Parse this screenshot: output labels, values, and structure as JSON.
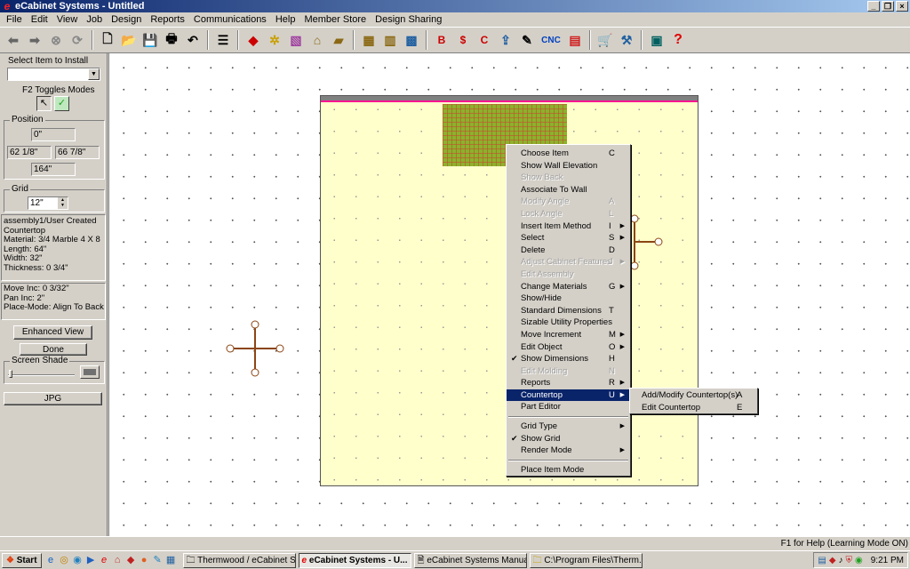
{
  "window": {
    "title": "eCabinet Systems - Untitled"
  },
  "menubar": [
    "File",
    "Edit",
    "View",
    "Job",
    "Design",
    "Reports",
    "Communications",
    "Help",
    "Member Store",
    "Design Sharing"
  ],
  "toolbar": {
    "cnc_label": "CNC"
  },
  "left_panel": {
    "select_label": "Select Item to Install",
    "select_value": "",
    "modes_label": "F2 Toggles Modes",
    "position_label": "Position",
    "position_values": {
      "top": "0\"",
      "left": "62 1/8\"",
      "right": "66 7/8\"",
      "bottom": "164\""
    },
    "grid_label": "Grid",
    "grid_value": "12\"",
    "info_lines": [
      "assembly1/User Created",
      "Countertop",
      " Material: 3/4 Marble 4 X 8",
      " Length: 64\"",
      " Width: 32\"",
      " Thickness: 0 3/4\""
    ],
    "move_lines": [
      "Move Inc: 0 3/32\"",
      "Pan Inc: 2\"",
      "Place-Mode: Align To Back"
    ],
    "enhanced_view_label": "Enhanced View",
    "done_label": "Done",
    "screen_shade_label": "Screen Shade",
    "jpg_label": "JPG"
  },
  "context_menu": [
    {
      "label": "Choose Item",
      "shortcut": "C"
    },
    {
      "label": "Show Wall Elevation",
      "shortcut": ""
    },
    {
      "label": "Show Back",
      "shortcut": "",
      "disabled": true
    },
    {
      "label": "Associate To Wall",
      "shortcut": ""
    },
    {
      "label": "Modify Angle",
      "shortcut": "A",
      "disabled": true
    },
    {
      "label": "Lock Angle",
      "shortcut": "L",
      "disabled": true
    },
    {
      "label": "Insert Item Method",
      "shortcut": "I",
      "submenu": true
    },
    {
      "label": "Select",
      "shortcut": "S",
      "submenu": true
    },
    {
      "label": "Delete",
      "shortcut": "D"
    },
    {
      "label": "Adjust Cabinet Features",
      "shortcut": "J",
      "submenu": true,
      "disabled": true
    },
    {
      "label": "Edit Assembly",
      "shortcut": "",
      "disabled": true
    },
    {
      "label": "Change Materials",
      "shortcut": "G",
      "submenu": true
    },
    {
      "label": "Show/Hide",
      "shortcut": ""
    },
    {
      "label": "Standard Dimensions",
      "shortcut": "T"
    },
    {
      "label": "Sizable Utility Properties",
      "shortcut": ""
    },
    {
      "label": "Move Increment",
      "shortcut": "M",
      "submenu": true
    },
    {
      "label": "Edit Object",
      "shortcut": "O",
      "submenu": true
    },
    {
      "label": "Show Dimensions",
      "shortcut": "H",
      "checked": true
    },
    {
      "label": "Edit Molding",
      "shortcut": "N",
      "disabled": true
    },
    {
      "label": "Reports",
      "shortcut": "R",
      "submenu": true
    },
    {
      "label": "Countertop",
      "shortcut": "U",
      "submenu": true,
      "highlight": true
    },
    {
      "label": "Part Editor",
      "shortcut": ""
    },
    {
      "separator": true
    },
    {
      "label": "Grid Type",
      "shortcut": "",
      "submenu": true
    },
    {
      "label": "Show Grid",
      "shortcut": "",
      "checked": true
    },
    {
      "label": "Render Mode",
      "shortcut": "",
      "submenu": true
    },
    {
      "separator": true
    },
    {
      "label": "Place Item Mode",
      "shortcut": ""
    }
  ],
  "submenu": [
    {
      "label": "Add/Modify Countertop(s)",
      "shortcut": "A"
    },
    {
      "label": "Edit Countertop",
      "shortcut": "E"
    }
  ],
  "statusbar": {
    "text": "F1 for Help (Learning Mode ON)"
  },
  "taskbar": {
    "start_label": "Start",
    "tasks": [
      {
        "label": "Thermwood / eCabinet S...",
        "active": false
      },
      {
        "label": "eCabinet Systems - U...",
        "active": true
      },
      {
        "label": "eCabinet Systems Manual",
        "active": false
      },
      {
        "label": "C:\\Program Files\\Therm...",
        "active": false
      }
    ],
    "clock": "9:21 PM"
  },
  "colors": {
    "title_start": "#0a246a",
    "room_fill": "#ffffcc",
    "wall_accent": "#ff1493",
    "countertop": "#8bb22b",
    "menu_highlight": "#0a246a"
  }
}
